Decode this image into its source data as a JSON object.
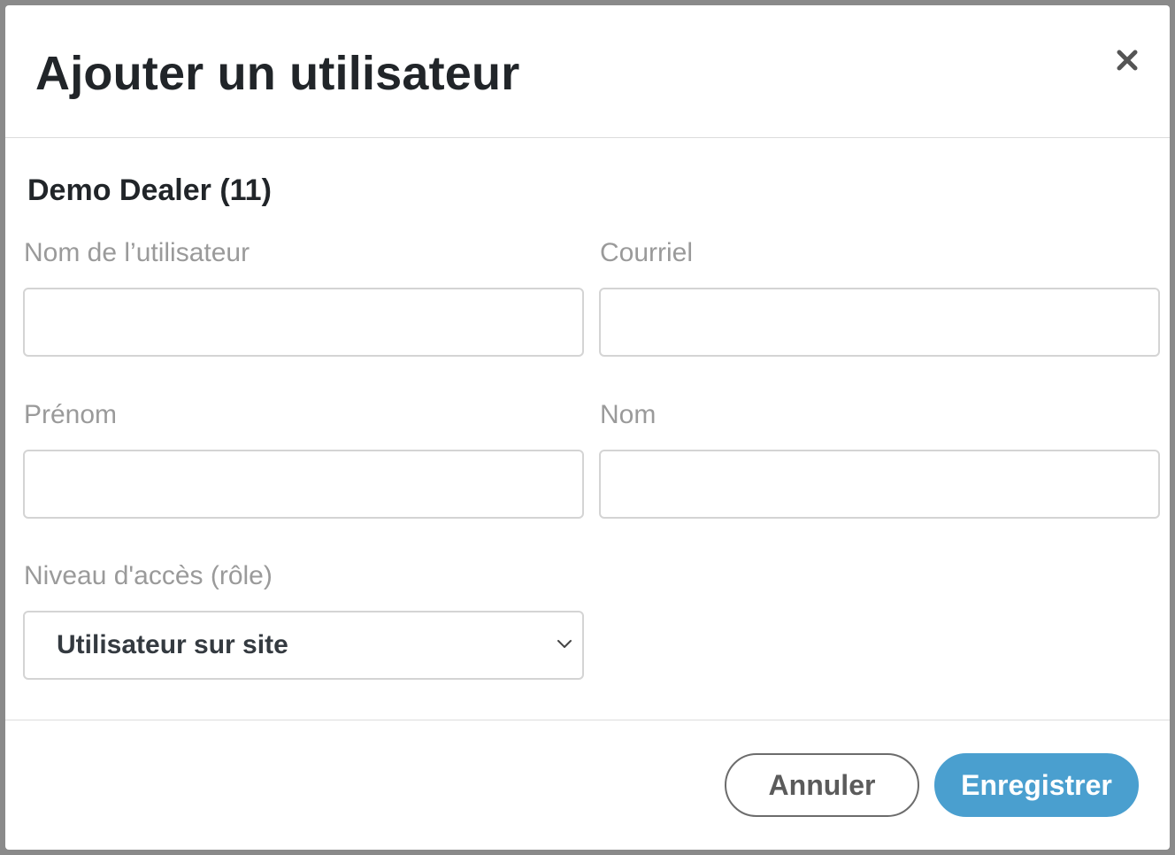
{
  "modal": {
    "title": "Ajouter un utilisateur",
    "close_icon": "close-icon"
  },
  "form": {
    "dealer": "Demo Dealer (11)",
    "username": {
      "label": "Nom de l’utilisateur",
      "value": ""
    },
    "email": {
      "label": "Courriel",
      "value": ""
    },
    "first_name": {
      "label": "Prénom",
      "value": ""
    },
    "last_name": {
      "label": "Nom",
      "value": ""
    },
    "role": {
      "label": "Niveau d'accès (rôle)",
      "selected": "Utilisateur sur site",
      "icon": "chevron-down-icon"
    }
  },
  "footer": {
    "cancel_label": "Annuler",
    "save_label": "Enregistrer"
  },
  "colors": {
    "primary": "#4a9fcf",
    "title": "#212529",
    "label": "#9a9a9a"
  }
}
